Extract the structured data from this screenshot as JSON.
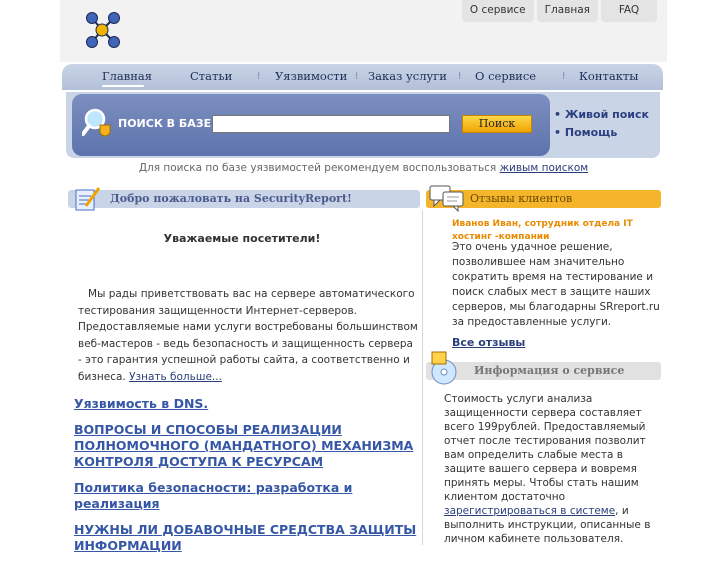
{
  "top_links": {
    "about": "О сервисе",
    "home": "Главная",
    "faq": "FAQ"
  },
  "nav": {
    "home": "Главная",
    "articles": "Статьи",
    "vulns": "Уязвимости",
    "order": "Заказ услуги",
    "about": "О сервисе",
    "contacts": "Контакты"
  },
  "search": {
    "label": "ПОИСК В БАЗЕ:",
    "value": "",
    "button": "Поиск",
    "live_search": "Живой поиск",
    "help": "Помощь",
    "hint_prefix": "Для поиска по базе уязвимостей рекомендуем воспользоваться",
    "hint_link": "живым поиском"
  },
  "welcome": {
    "header": "Добро пожаловать на SecurityReport!",
    "greeting": "Уважаемые посетители!",
    "intro": "Мы рады приветствовать вас на сервере автоматического тестирования защищенности Интернет-серверов. Предоставляемые нами услуги востребованы большинством веб-мастеров - ведь безопасность и защищенность сервера - это гарантия успешной работы сайта, а соответственно и бизнеса.",
    "more_link": "Узнать больше..."
  },
  "articles": [
    "Уязвимость в DNS.",
    "ВОПРОСЫ И СПОСОБЫ РЕАЛИЗАЦИИ ПОЛНОМОЧНОГО (МАНДАТНОГО) МЕХАНИЗМА КОНТРОЛЯ ДОСТУПА К РЕСУРСАМ",
    "Политика безопасности: разработка и реализация",
    "НУЖНЫ ЛИ ДОБАВОЧНЫЕ СРЕДСТВА ЗАЩИТЫ ИНФОРМАЦИИ"
  ],
  "reviews": {
    "header": "Отзывы клиентов",
    "author": "Иванов Иван, сотрудник отдела IT хостинг -компании",
    "text": "Это очень удачное решение, позволившее нам значительно сократить время на тестирование и поиск слабых мест в защите наших серверов, мы благодарны SRreport.ru за предоставленные услуги.",
    "all_link": "Все отзывы"
  },
  "info": {
    "header": "Информация о сервисе",
    "text_before": "Стоимость услуги анализа защищенности сервера составляет всего  199рублей. Предоставляемый отчет после тестирования позволит вам определить слабые места в защите вашего сервера и вовремя принять меры. Чтобы стать нашим клиентом достаточно",
    "register_link": "зарегистрироваться в системе",
    "text_after": ", и выполнить инструкции, описанные в личном кабинете пользователя."
  },
  "colors": {
    "nav_bg": "#c9d4e6",
    "search_bg": "#6a7fb6",
    "accent_orange": "#f5b52a",
    "link": "#3557a6"
  }
}
